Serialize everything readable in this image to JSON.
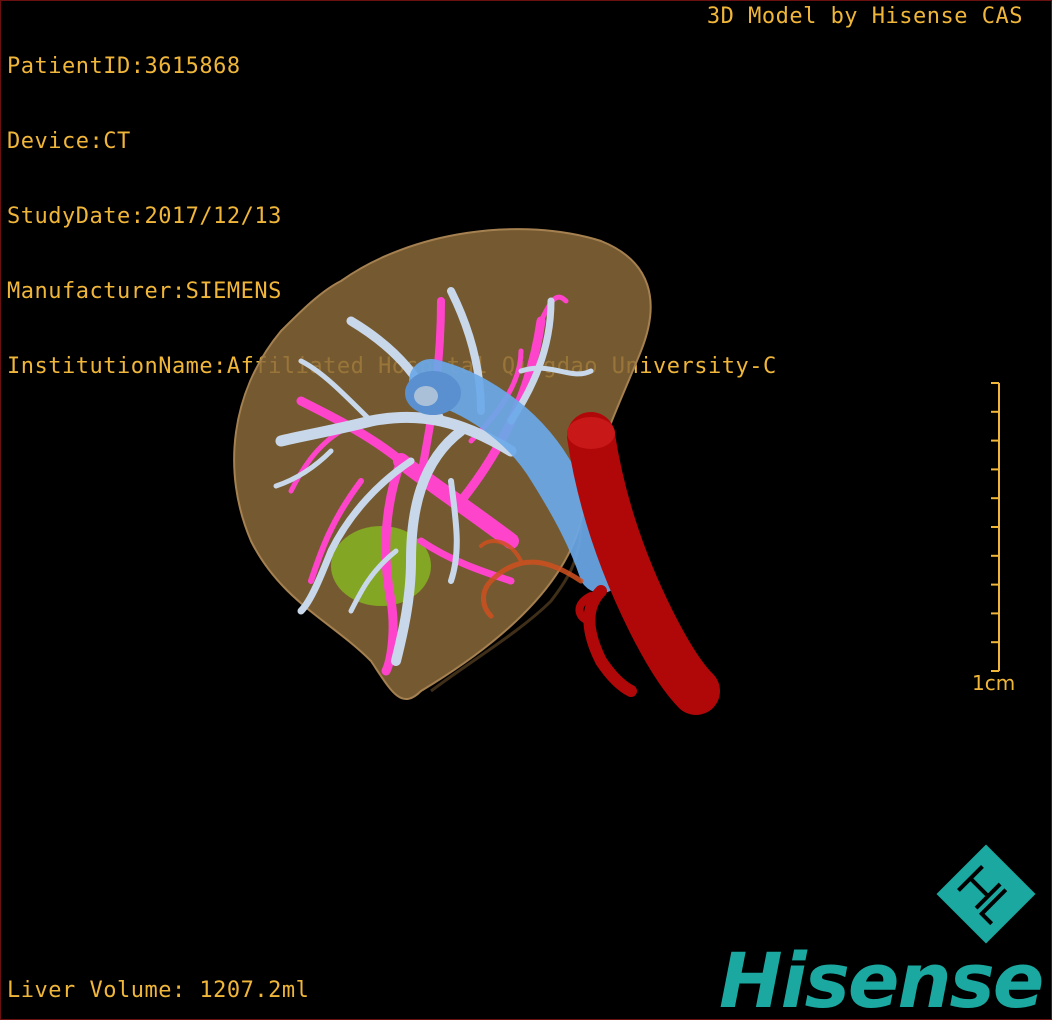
{
  "patient_info": [
    "PatientID:3615868",
    "Device:CT",
    "StudyDate:2017/12/13",
    "Manufacturer:SIEMENS",
    "InstitutionName:Affiliated Hospital Qingdao University-C"
  ],
  "brand_caption": "3D Model by Hisense CAS",
  "liver_volume": "Liver Volume: 1207.2ml",
  "scale": {
    "label": "1cm",
    "tick_count": 10
  },
  "logo": {
    "wordmark": "Hisense",
    "mark_letters": "HL",
    "color": "#1aa8a0"
  },
  "colors": {
    "overlay_text": "#f0b63a",
    "liver": "#8a6a3a",
    "hepatic_vein": "#c8d8ea",
    "portal_vein": "#ff44cc",
    "ivc": "#6aa8e8",
    "aorta": "#b00808",
    "gallbladder": "#88c020",
    "artery": "#d05020"
  }
}
